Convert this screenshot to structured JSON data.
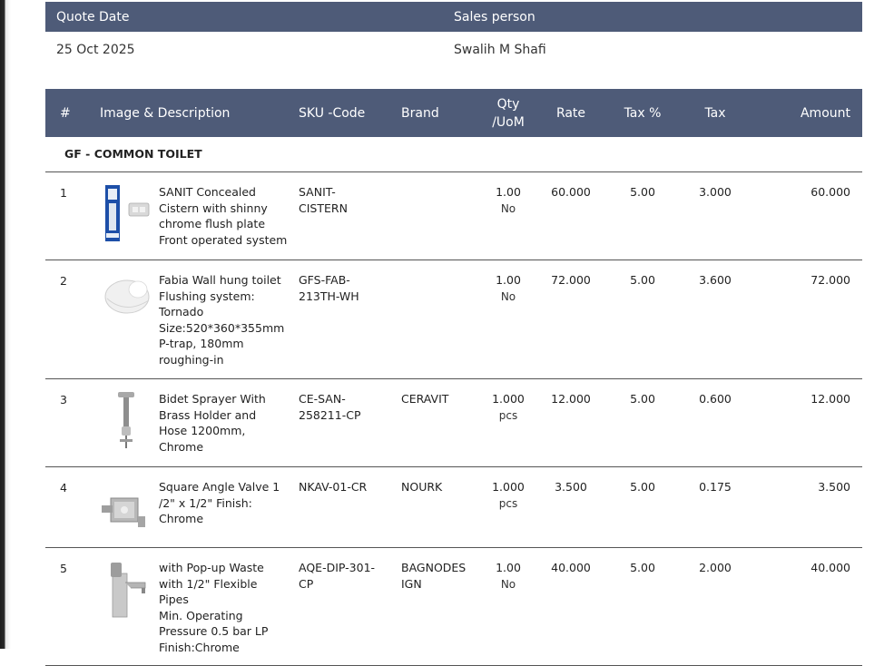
{
  "meta": {
    "quote_date_label": "Quote Date",
    "sales_person_label": "Sales person",
    "quote_date": "25 Oct 2025",
    "sales_person": "Swalih M Shafi"
  },
  "columns": {
    "num": "#",
    "desc": "Image & Description",
    "sku": "SKU -Code",
    "brand": "Brand",
    "qty_line1": "Qty",
    "qty_line2": "/UoM",
    "rate": "Rate",
    "tax_pct": "Tax %",
    "tax": "Tax",
    "amount": "Amount"
  },
  "section_title": "GF - COMMON TOILET",
  "items": [
    {
      "num": "1",
      "image": "concealed-cistern-image",
      "desc_lines": [
        "SANIT Concealed",
        "Cistern with shinny",
        "chrome flush plate",
        "Front operated system"
      ],
      "sku_lines": [
        "SANIT-",
        "CISTERN"
      ],
      "brand_lines": [],
      "qty": "1.00",
      "uom": "No",
      "rate": "60.000",
      "tax_pct": "5.00",
      "tax": "3.000",
      "amount": "60.000"
    },
    {
      "num": "2",
      "image": "wall-hung-toilet-image",
      "desc_lines": [
        "Fabia Wall hung toilet",
        "Flushing system:",
        "Tornado",
        "Size:520*360*355mm",
        "P-trap, 180mm",
        "roughing-in"
      ],
      "sku_lines": [
        "GFS-FAB-",
        "213TH-WH"
      ],
      "brand_lines": [],
      "qty": "1.00",
      "uom": "No",
      "rate": "72.000",
      "tax_pct": "5.00",
      "tax": "3.600",
      "amount": "72.000"
    },
    {
      "num": "3",
      "image": "bidet-sprayer-image",
      "desc_lines": [
        "Bidet Sprayer With",
        "Brass Holder and",
        "Hose 1200mm,",
        "Chrome"
      ],
      "sku_lines": [
        "CE-SAN-",
        "258211-CP"
      ],
      "brand_lines": [
        "CERAVIT"
      ],
      "qty": "1.000",
      "uom": "pcs",
      "rate": "12.000",
      "tax_pct": "5.00",
      "tax": "0.600",
      "amount": "12.000"
    },
    {
      "num": "4",
      "image": "angle-valve-image",
      "desc_lines": [
        "Square Angle Valve 1",
        "/2\" x 1/2\" Finish:",
        "Chrome"
      ],
      "sku_lines": [
        "NKAV-01-CR"
      ],
      "brand_lines": [
        "NOURK"
      ],
      "qty": "1.000",
      "uom": "pcs",
      "rate": "3.500",
      "tax_pct": "5.00",
      "tax": "0.175",
      "amount": "3.500"
    },
    {
      "num": "5",
      "image": "basin-mixer-image",
      "desc_lines": [
        "with Pop-up Waste",
        "with 1/2\" Flexible",
        "Pipes",
        "Min. Operating",
        "Pressure 0.5 bar LP",
        "Finish:Chrome"
      ],
      "sku_lines": [
        "AQE-DIP-301-",
        "CP"
      ],
      "brand_lines": [
        "BAGNODES",
        "IGN"
      ],
      "qty": "1.00",
      "uom": "No",
      "rate": "40.000",
      "tax_pct": "5.00",
      "tax": "2.000",
      "amount": "40.000"
    }
  ],
  "colors": {
    "header_bg": "#4e5b78",
    "header_text": "#ffffff",
    "rule": "#555555"
  }
}
